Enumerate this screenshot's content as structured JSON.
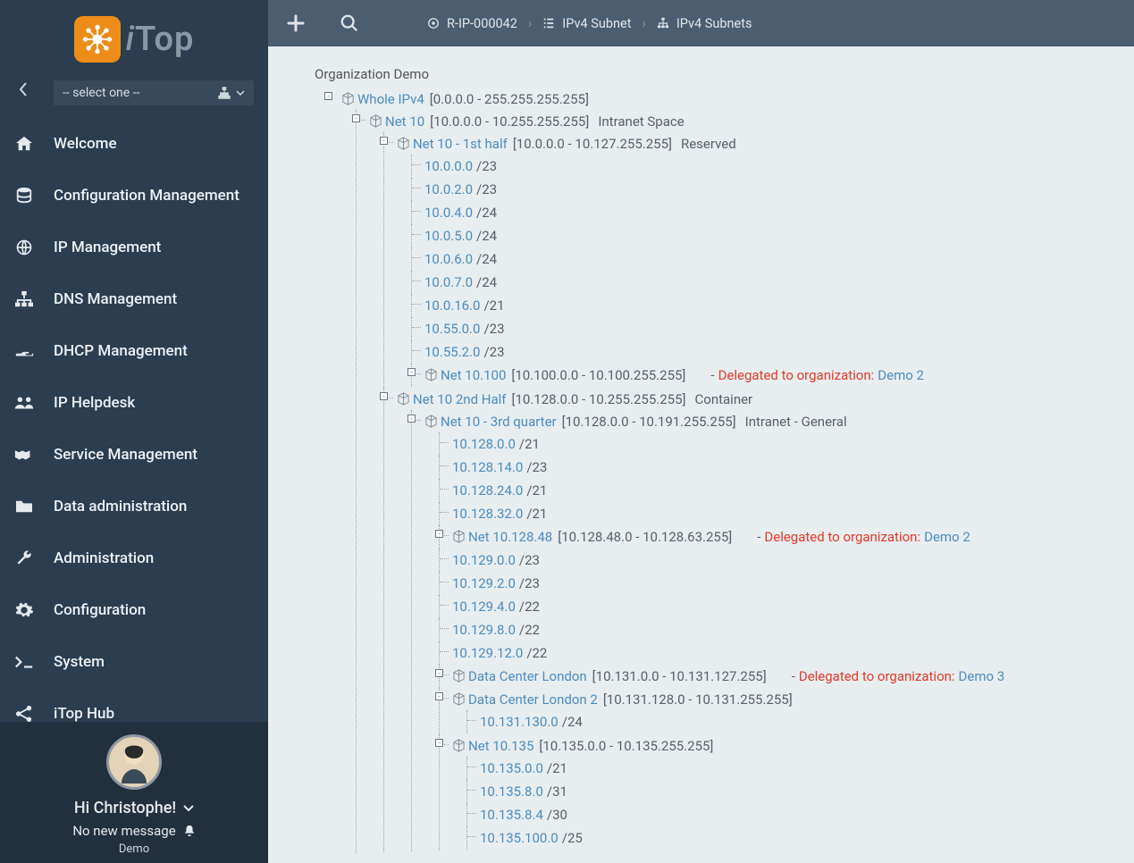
{
  "app": {
    "name": "iTop",
    "org_select_placeholder": "-- select one --"
  },
  "nav": {
    "items": [
      {
        "label": "Welcome"
      },
      {
        "label": "Configuration Management"
      },
      {
        "label": "IP Management"
      },
      {
        "label": "DNS Management"
      },
      {
        "label": "DHCP Management"
      },
      {
        "label": "IP Helpdesk"
      },
      {
        "label": "Service Management"
      },
      {
        "label": "Data administration"
      },
      {
        "label": "Administration"
      },
      {
        "label": "Configuration"
      },
      {
        "label": "System"
      },
      {
        "label": "iTop Hub"
      }
    ]
  },
  "user": {
    "greeting": "Hi Christophe!",
    "message": "No new message",
    "tag": "Demo"
  },
  "breadcrumbs": [
    {
      "label": "R-IP-000042"
    },
    {
      "label": "IPv4 Subnet"
    },
    {
      "label": "IPv4 Subnets"
    }
  ],
  "page": {
    "org_title": "Organization Demo",
    "delegated_label": "Delegated to organization:"
  },
  "tree": {
    "root": {
      "name": "Whole IPv4",
      "range": "[0.0.0.0 - 255.255.255.255]",
      "label": ""
    },
    "net10": {
      "name": "Net 10",
      "range": "[10.0.0.0 - 10.255.255.255]",
      "label": "Intranet Space"
    },
    "net10_1st": {
      "name": "Net 10 - 1st half",
      "range": "[10.0.0.0 - 10.127.255.255]",
      "label": "Reserved",
      "subnets": [
        {
          "ip": "10.0.0.0",
          "cidr": "/23"
        },
        {
          "ip": "10.0.2.0",
          "cidr": "/23"
        },
        {
          "ip": "10.0.4.0",
          "cidr": "/24"
        },
        {
          "ip": "10.0.5.0",
          "cidr": "/24"
        },
        {
          "ip": "10.0.6.0",
          "cidr": "/24"
        },
        {
          "ip": "10.0.7.0",
          "cidr": "/24"
        },
        {
          "ip": "10.0.16.0",
          "cidr": "/21"
        },
        {
          "ip": "10.55.0.0",
          "cidr": "/23"
        },
        {
          "ip": "10.55.2.0",
          "cidr": "/23"
        }
      ]
    },
    "net10_100": {
      "name": "Net 10.100",
      "range": "[10.100.0.0 - 10.100.255.255]",
      "del_org": "Demo 2"
    },
    "net10_2nd": {
      "name": "Net 10 2nd Half",
      "range": "[10.128.0.0 - 10.255.255.255]",
      "label": "Container"
    },
    "net10_3rd": {
      "name": "Net 10 - 3rd quarter",
      "range": "[10.128.0.0 - 10.191.255.255]",
      "label": "Intranet - General",
      "subnets_a": [
        {
          "ip": "10.128.0.0",
          "cidr": "/21"
        },
        {
          "ip": "10.128.14.0",
          "cidr": "/23"
        },
        {
          "ip": "10.128.24.0",
          "cidr": "/21"
        },
        {
          "ip": "10.128.32.0",
          "cidr": "/21"
        }
      ],
      "net10_128_48": {
        "name": "Net 10.128.48",
        "range": "[10.128.48.0 - 10.128.63.255]",
        "del_org": "Demo 2"
      },
      "subnets_b": [
        {
          "ip": "10.129.0.0",
          "cidr": "/23"
        },
        {
          "ip": "10.129.2.0",
          "cidr": "/23"
        },
        {
          "ip": "10.129.4.0",
          "cidr": "/22"
        },
        {
          "ip": "10.129.8.0",
          "cidr": "/22"
        },
        {
          "ip": "10.129.12.0",
          "cidr": "/22"
        }
      ],
      "dc_london": {
        "name": "Data Center London",
        "range": "[10.131.0.0 - 10.131.127.255]",
        "del_org": "Demo 3"
      },
      "dc_london2": {
        "name": "Data Center London 2",
        "range": "[10.131.128.0 - 10.131.255.255]",
        "subnets": [
          {
            "ip": "10.131.130.0",
            "cidr": "/24"
          }
        ]
      },
      "net10_135": {
        "name": "Net 10.135",
        "range": "[10.135.0.0 - 10.135.255.255]",
        "subnets": [
          {
            "ip": "10.135.0.0",
            "cidr": "/21"
          },
          {
            "ip": "10.135.8.0",
            "cidr": "/31"
          },
          {
            "ip": "10.135.8.4",
            "cidr": "/30"
          },
          {
            "ip": "10.135.100.0",
            "cidr": "/25"
          }
        ]
      }
    }
  }
}
